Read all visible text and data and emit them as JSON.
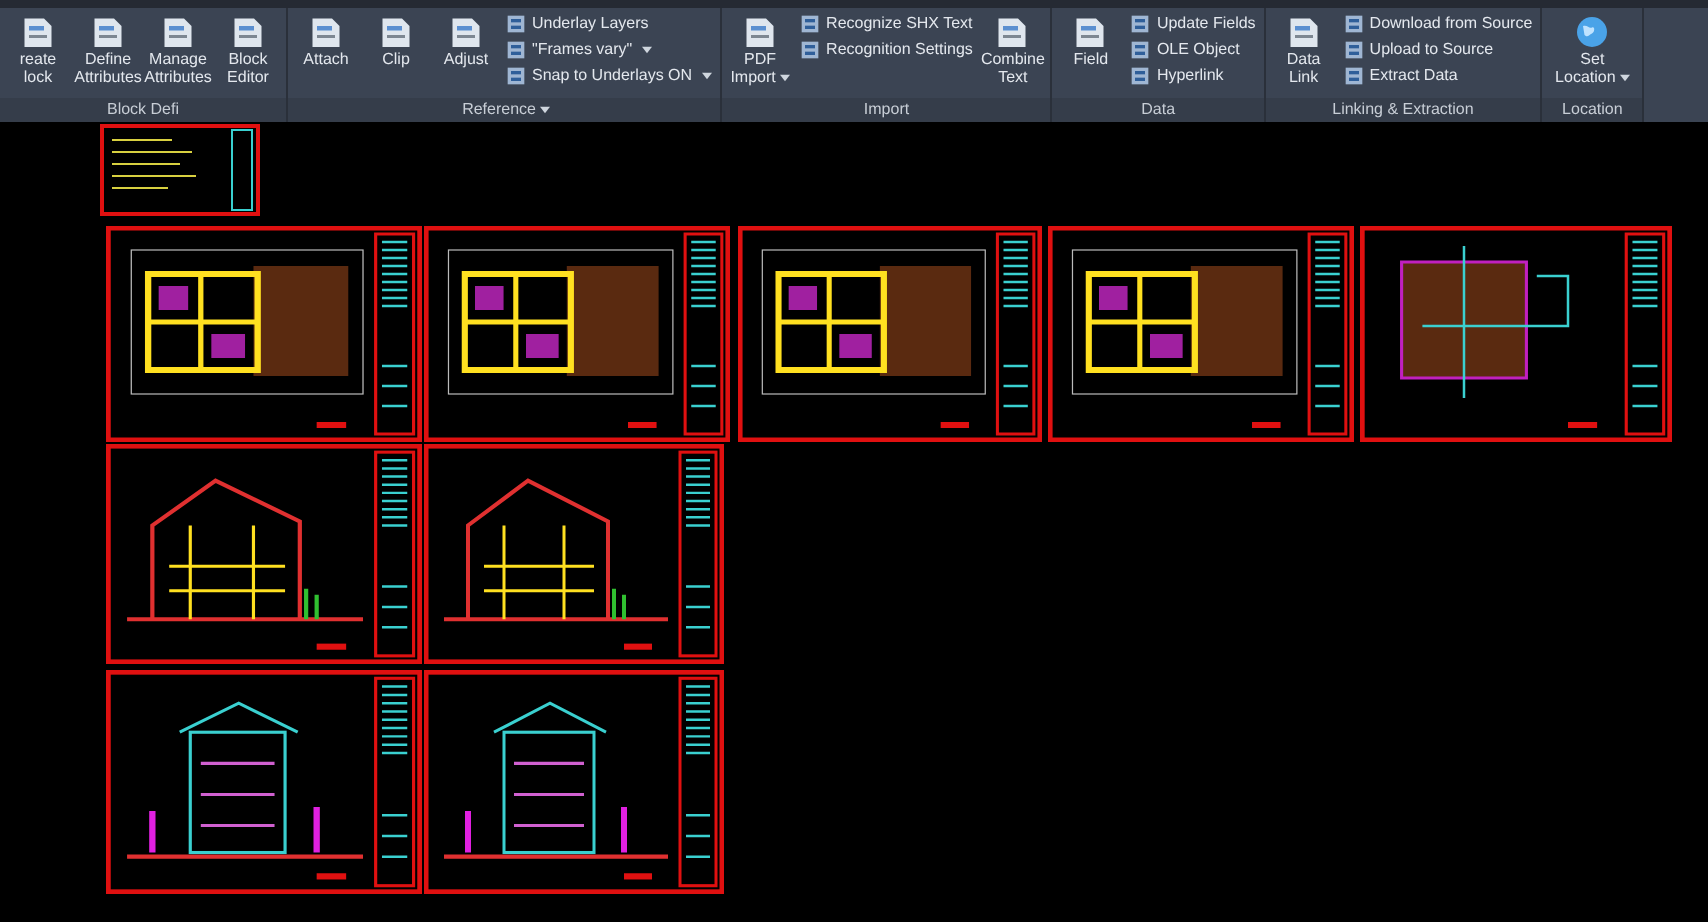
{
  "ribbon": {
    "panels": [
      {
        "title": "Block Defi",
        "dropdown": false,
        "tools": [
          {
            "kind": "large",
            "label": "reate lock",
            "dropdown": false
          },
          {
            "kind": "large",
            "label": "Define Attributes",
            "dropdown": false
          },
          {
            "kind": "large",
            "label": "Manage Attributes",
            "dropdown": false
          },
          {
            "kind": "large",
            "label": "Block Editor",
            "dropdown": false
          }
        ]
      },
      {
        "title": "Reference",
        "dropdown": true,
        "tools": [
          {
            "kind": "large",
            "label": "Attach",
            "dropdown": false
          },
          {
            "kind": "large",
            "label": "Clip",
            "dropdown": false
          },
          {
            "kind": "large",
            "label": "Adjust",
            "dropdown": false
          },
          {
            "kind": "small",
            "label": "Underlay Layers",
            "dropdown": false
          },
          {
            "kind": "small",
            "label": "\"Frames vary\"",
            "dropdown": true
          },
          {
            "kind": "small",
            "label": "Snap to Underlays ON",
            "dropdown": true
          }
        ]
      },
      {
        "title": "Import",
        "dropdown": false,
        "tools": [
          {
            "kind": "large",
            "label": "PDF Import",
            "dropdown": true
          },
          {
            "kind": "small",
            "label": "Recognize SHX Text",
            "dropdown": false
          },
          {
            "kind": "small",
            "label": "Recognition Settings",
            "dropdown": false
          },
          {
            "kind": "large",
            "label": "Combine Text",
            "dropdown": false
          }
        ]
      },
      {
        "title": "Data",
        "dropdown": false,
        "tools": [
          {
            "kind": "large",
            "label": "Field",
            "dropdown": false
          },
          {
            "kind": "small",
            "label": "Update Fields",
            "dropdown": false
          },
          {
            "kind": "small",
            "label": "OLE Object",
            "dropdown": false
          },
          {
            "kind": "small",
            "label": "Hyperlink",
            "dropdown": false
          }
        ]
      },
      {
        "title": "Linking & Extraction",
        "dropdown": false,
        "tools": [
          {
            "kind": "large",
            "label": "Data Link",
            "dropdown": false
          },
          {
            "kind": "small",
            "label": "Download from Source",
            "dropdown": false
          },
          {
            "kind": "small",
            "label": "Upload to Source",
            "dropdown": false
          },
          {
            "kind": "small",
            "label": "Extract  Data",
            "dropdown": false
          }
        ]
      },
      {
        "title": "Location",
        "dropdown": false,
        "tools": [
          {
            "kind": "globe",
            "label": "Set Location",
            "dropdown": true
          }
        ]
      }
    ]
  },
  "drawing": {
    "sheets": [
      {
        "kind": "plan"
      },
      {
        "kind": "plan"
      },
      {
        "kind": "plan"
      },
      {
        "kind": "plan"
      },
      {
        "kind": "roof"
      },
      {
        "kind": "section"
      },
      {
        "kind": "section"
      },
      {
        "kind": "elevation"
      },
      {
        "kind": "elevation"
      }
    ]
  }
}
